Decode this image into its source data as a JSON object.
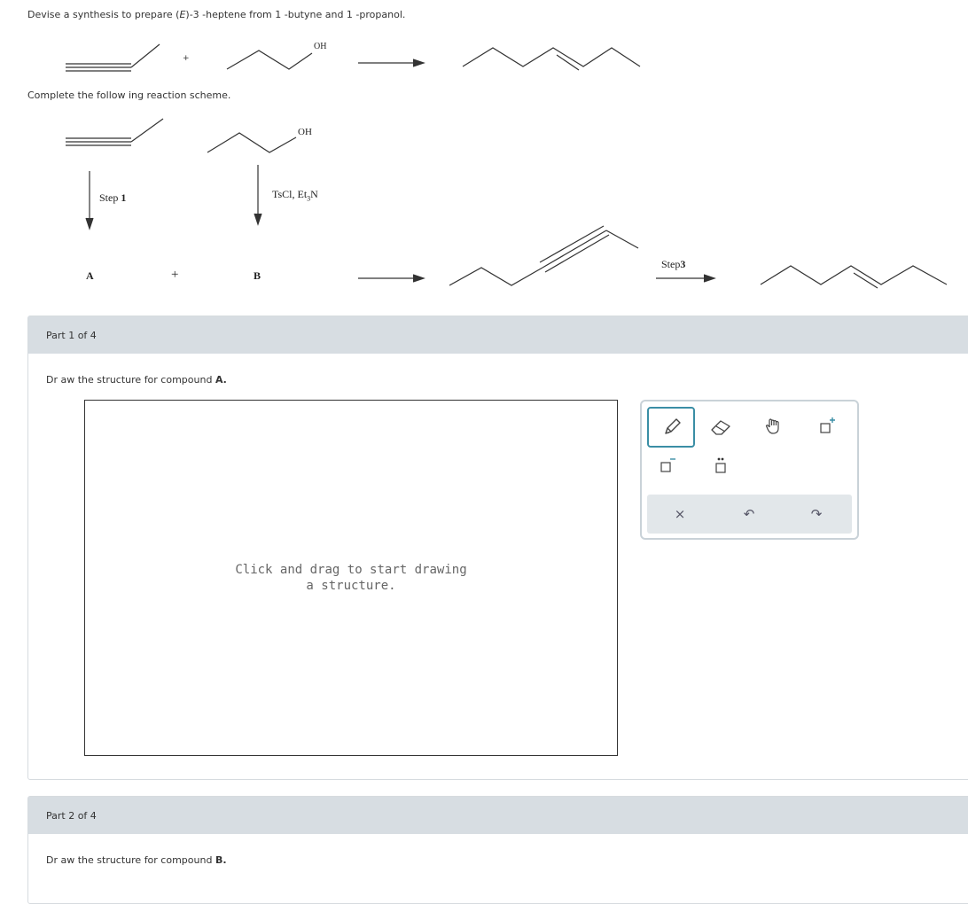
{
  "question": {
    "intro_parts": [
      "Devise a synthesis to prepare (",
      "E",
      ")-3 -heptene from 1 -butyne and 1 -propanol."
    ],
    "instruction": "Complete the follow ing reaction scheme.",
    "oh_label": "OH",
    "plus": "+",
    "step1_label": "Step",
    "step1_num": "1",
    "reagent_main": "TsCl, Et",
    "reagent_sub": "3",
    "reagent_end": "N",
    "label_a": "A",
    "label_b": "B",
    "step3_label": "Step",
    "step3_num": "3"
  },
  "part1": {
    "header": "Part 1 of 4",
    "prompt": "Dr aw the structure for compound",
    "compound": "A.",
    "canvas_hint_line1": "Click and drag to start drawing",
    "canvas_hint_line2": "a structure."
  },
  "part2": {
    "header": "Part 2 of 4",
    "prompt": "Dr aw the structure for compound",
    "compound": "B."
  },
  "toolbar": {
    "tools": [
      {
        "name": "pencil-icon",
        "selected": true
      },
      {
        "name": "eraser-icon",
        "selected": false
      },
      {
        "name": "hand-icon",
        "selected": false
      },
      {
        "name": "increase-charge-icon",
        "selected": false
      },
      {
        "name": "decrease-charge-icon",
        "selected": false
      },
      {
        "name": "lone-pair-icon",
        "selected": false
      }
    ],
    "clear_symbol": "×",
    "undo_symbol": "↶",
    "redo_symbol": "↷"
  },
  "colors": {
    "accent": "#3a8ea5",
    "header_bg": "#d7dde2",
    "toolbar_bottom_bg": "#e2e7ea",
    "canvas_hint": "#666666"
  }
}
